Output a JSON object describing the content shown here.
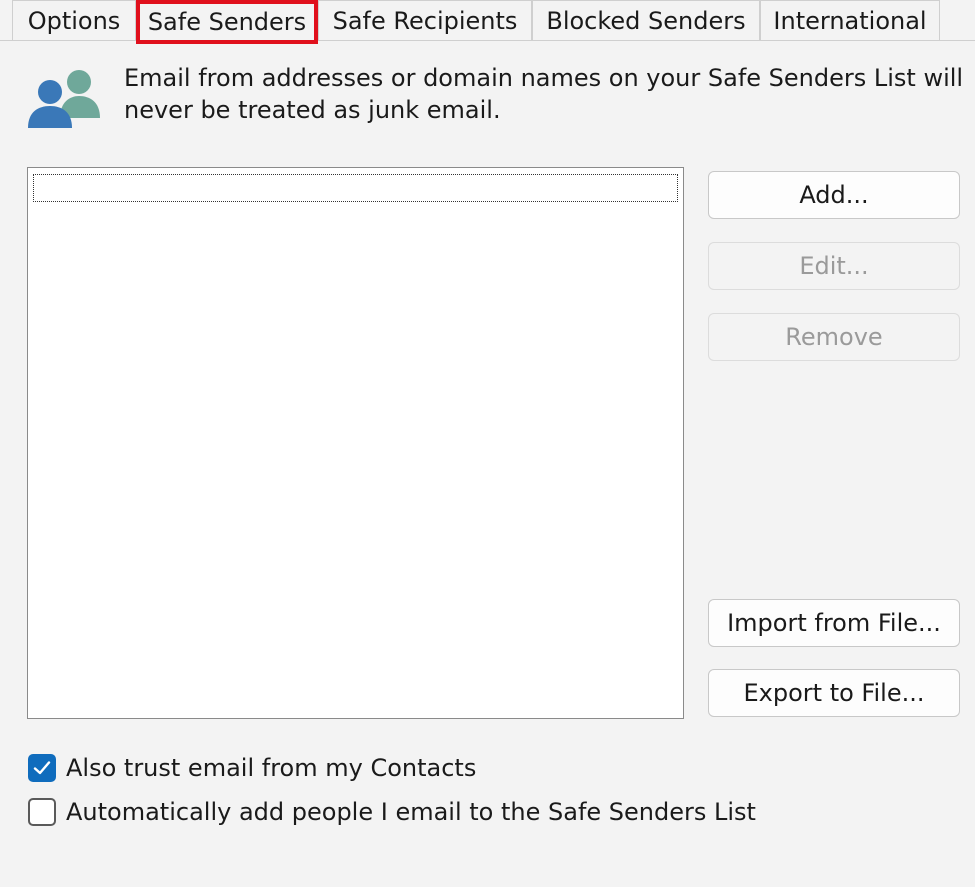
{
  "tabs": [
    {
      "label": "Options"
    },
    {
      "label": "Safe Senders",
      "active": true
    },
    {
      "label": "Safe Recipients"
    },
    {
      "label": "Blocked Senders"
    },
    {
      "label": "International"
    }
  ],
  "info": {
    "icon": "people-icon",
    "text": "Email from addresses or domain names on your Safe Senders List will never be treated as junk email."
  },
  "list": {
    "items": []
  },
  "buttons": {
    "add": "Add...",
    "edit": "Edit...",
    "remove": "Remove",
    "import": "Import from File...",
    "export": "Export to File..."
  },
  "checkboxes": {
    "trust_contacts": {
      "label": "Also trust email from my Contacts",
      "checked": true
    },
    "auto_add": {
      "label": "Automatically add people I email to the Safe Senders List",
      "checked": false
    }
  },
  "colors": {
    "highlight": "#e0101c",
    "checkbox_accent": "#0f6cbd",
    "icon_blue": "#3a78b8",
    "icon_green": "#6fa89a"
  }
}
